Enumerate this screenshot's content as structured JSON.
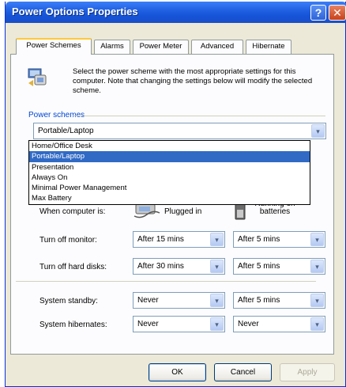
{
  "window": {
    "title": "Power Options Properties"
  },
  "titlebar": {
    "help_glyph": "?",
    "close_glyph": "✕"
  },
  "tabs": [
    {
      "label": "Power Schemes",
      "active": true
    },
    {
      "label": "Alarms",
      "active": false
    },
    {
      "label": "Power Meter",
      "active": false
    },
    {
      "label": "Advanced",
      "active": false
    },
    {
      "label": "Hibernate",
      "active": false
    }
  ],
  "intro": {
    "icon": "power-scheme-icon",
    "text": "Select the power scheme with the most appropriate settings for this computer. Note that changing the settings below will modify the selected scheme."
  },
  "schemes": {
    "group_label": "Power schemes",
    "selected": "Portable/Laptop",
    "options": [
      "Home/Office Desk",
      "Portable/Laptop",
      "Presentation",
      "Always On",
      "Minimal Power Management",
      "Max Battery"
    ],
    "highlighted": "Portable/Laptop"
  },
  "settings": {
    "when_label": "When computer is:",
    "plugged_in": "Plugged in",
    "on_batteries": "Running on batteries",
    "rows": [
      {
        "label": "Turn off monitor:",
        "plugged": "After 15 mins",
        "battery": "After 5 mins"
      },
      {
        "label": "Turn off hard disks:",
        "plugged": "After 30 mins",
        "battery": "After 5 mins"
      },
      {
        "label": "System standby:",
        "plugged": "Never",
        "battery": "After 5 mins"
      },
      {
        "label": "System hibernates:",
        "plugged": "Never",
        "battery": "Never"
      }
    ]
  },
  "buttons": {
    "ok": "OK",
    "cancel": "Cancel",
    "apply": "Apply"
  },
  "arrow_glyph": "▾",
  "colors": {
    "titlebar": "#1e5ee0",
    "selection": "#316ac5",
    "group_label": "#0046d5"
  }
}
